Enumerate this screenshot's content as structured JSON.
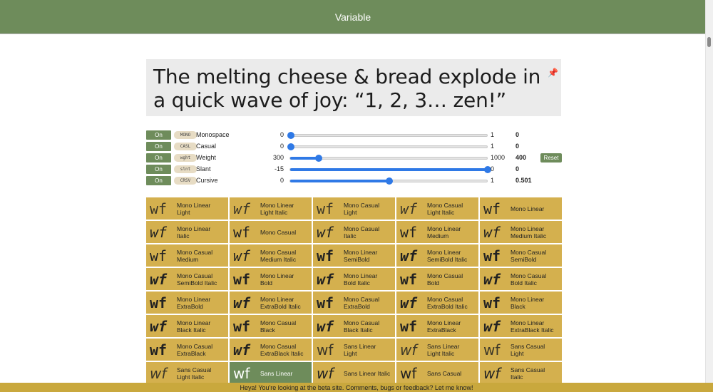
{
  "header": {
    "title": "Variable"
  },
  "preview": {
    "text": "The melting cheese & bread explode in a quick wave of joy: “1, 2, 3… zen!”"
  },
  "axes": [
    {
      "toggle": "On",
      "tag": "MONO",
      "name": "Monospace",
      "min": "0",
      "max": "1",
      "value": "0",
      "fraction": 0
    },
    {
      "toggle": "On",
      "tag": "CASL",
      "name": "Casual",
      "min": "0",
      "max": "1",
      "value": "0",
      "fraction": 0
    },
    {
      "toggle": "On",
      "tag": "wght",
      "name": "Weight",
      "min": "300",
      "max": "1000",
      "value": "400",
      "fraction": 0.143,
      "reset": "Reset"
    },
    {
      "toggle": "On",
      "tag": "slnt",
      "name": "Slant",
      "min": "-15",
      "max": "0",
      "value": "0",
      "fraction": 1
    },
    {
      "toggle": "On",
      "tag": "CRSV",
      "name": "Cursive",
      "min": "0",
      "max": "1",
      "value": "0.501",
      "fraction": 0.501
    }
  ],
  "sample_glyph": "wf",
  "styles": [
    {
      "line1": "Mono Linear",
      "line2": "Light",
      "mono": true,
      "weight": 300,
      "italic": false
    },
    {
      "line1": "Mono Linear",
      "line2": "Light Italic",
      "mono": true,
      "weight": 300,
      "italic": true
    },
    {
      "line1": "Mono Casual",
      "line2": "Light",
      "mono": true,
      "weight": 300,
      "italic": false
    },
    {
      "line1": "Mono Casual",
      "line2": "Light Italic",
      "mono": true,
      "weight": 300,
      "italic": true
    },
    {
      "line1": "Mono Linear",
      "line2": "",
      "mono": true,
      "weight": 400,
      "italic": false
    },
    {
      "line1": "Mono Linear",
      "line2": "Italic",
      "mono": true,
      "weight": 400,
      "italic": true
    },
    {
      "line1": "Mono Casual",
      "line2": "",
      "mono": true,
      "weight": 400,
      "italic": false
    },
    {
      "line1": "Mono Casual",
      "line2": "Italic",
      "mono": true,
      "weight": 400,
      "italic": true
    },
    {
      "line1": "Mono Linear",
      "line2": "Medium",
      "mono": true,
      "weight": 500,
      "italic": false
    },
    {
      "line1": "Mono Linear",
      "line2": "Medium Italic",
      "mono": true,
      "weight": 500,
      "italic": true
    },
    {
      "line1": "Mono Casual",
      "line2": "Medium",
      "mono": true,
      "weight": 500,
      "italic": false
    },
    {
      "line1": "Mono Casual",
      "line2": "Medium Italic",
      "mono": true,
      "weight": 500,
      "italic": true
    },
    {
      "line1": "Mono Linear",
      "line2": "SemiBold",
      "mono": true,
      "weight": 600,
      "italic": false
    },
    {
      "line1": "Mono Linear",
      "line2": "SemiBold Italic",
      "mono": true,
      "weight": 600,
      "italic": true
    },
    {
      "line1": "Mono Casual",
      "line2": "SemiBold",
      "mono": true,
      "weight": 600,
      "italic": false
    },
    {
      "line1": "Mono Casual",
      "line2": "SemiBold Italic",
      "mono": true,
      "weight": 600,
      "italic": true
    },
    {
      "line1": "Mono Linear",
      "line2": "Bold",
      "mono": true,
      "weight": 700,
      "italic": false
    },
    {
      "line1": "Mono Linear",
      "line2": "Bold Italic",
      "mono": true,
      "weight": 700,
      "italic": true
    },
    {
      "line1": "Mono Casual",
      "line2": "Bold",
      "mono": true,
      "weight": 700,
      "italic": false
    },
    {
      "line1": "Mono Casual",
      "line2": "Bold Italic",
      "mono": true,
      "weight": 700,
      "italic": true
    },
    {
      "line1": "Mono Linear",
      "line2": "ExtraBold",
      "mono": true,
      "weight": 800,
      "italic": false
    },
    {
      "line1": "Mono Linear",
      "line2": "ExtraBold Italic",
      "mono": true,
      "weight": 800,
      "italic": true
    },
    {
      "line1": "Mono Casual",
      "line2": "ExtraBold",
      "mono": true,
      "weight": 800,
      "italic": false
    },
    {
      "line1": "Mono Casual",
      "line2": "ExtraBold Italic",
      "mono": true,
      "weight": 800,
      "italic": true
    },
    {
      "line1": "Mono Linear",
      "line2": "Black",
      "mono": true,
      "weight": 900,
      "italic": false
    },
    {
      "line1": "Mono Linear",
      "line2": "Black Italic",
      "mono": true,
      "weight": 900,
      "italic": true
    },
    {
      "line1": "Mono Casual",
      "line2": "Black",
      "mono": true,
      "weight": 900,
      "italic": false
    },
    {
      "line1": "Mono Casual",
      "line2": "Black Italic",
      "mono": true,
      "weight": 900,
      "italic": true
    },
    {
      "line1": "Mono Linear",
      "line2": "ExtraBlack",
      "mono": true,
      "weight": 900,
      "italic": false
    },
    {
      "line1": "Mono Linear",
      "line2": "ExtraBlack Italic",
      "mono": true,
      "weight": 900,
      "italic": true
    },
    {
      "line1": "Mono Casual",
      "line2": "ExtraBlack",
      "mono": true,
      "weight": 900,
      "italic": false
    },
    {
      "line1": "Mono Casual",
      "line2": "ExtraBlack Italic",
      "mono": true,
      "weight": 900,
      "italic": true
    },
    {
      "line1": "Sans Linear",
      "line2": "Light",
      "mono": false,
      "weight": 300,
      "italic": false
    },
    {
      "line1": "Sans Linear",
      "line2": "Light Italic",
      "mono": false,
      "weight": 300,
      "italic": true
    },
    {
      "line1": "Sans Casual",
      "line2": "Light",
      "mono": false,
      "weight": 300,
      "italic": false
    },
    {
      "line1": "Sans Casual",
      "line2": "Light Italic",
      "mono": false,
      "weight": 300,
      "italic": true
    },
    {
      "line1": "Sans Linear",
      "line2": "",
      "mono": false,
      "weight": 400,
      "italic": false,
      "active": true
    },
    {
      "line1": "Sans Linear Italic",
      "line2": "",
      "mono": false,
      "weight": 400,
      "italic": true
    },
    {
      "line1": "Sans Casual",
      "line2": "",
      "mono": false,
      "weight": 400,
      "italic": false
    },
    {
      "line1": "Sans Casual",
      "line2": "Italic",
      "mono": false,
      "weight": 400,
      "italic": true
    }
  ],
  "colors": {
    "header": "#6e8c5b",
    "cell": "#d4b04e",
    "active_cell": "#6e8c5b",
    "footer": "#c9a83d",
    "slider": "#2f79e6"
  },
  "footer": {
    "text": "Heya! You're looking at the beta site. Comments, bugs or feedback? Let me know!"
  }
}
